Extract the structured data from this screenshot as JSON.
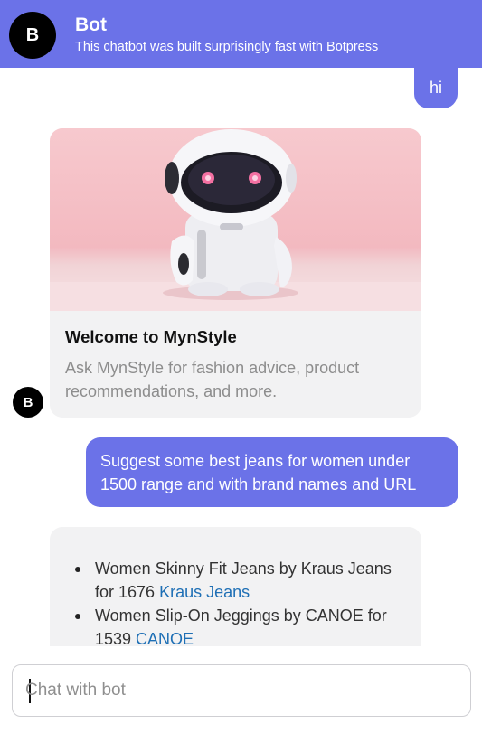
{
  "header": {
    "avatar_letter": "B",
    "bot_name": "Bot",
    "subtitle": "This chatbot was built surprisingly fast with Botpress"
  },
  "messages": {
    "user_greeting": "hi",
    "card": {
      "image_icon": "robot-illustration",
      "title": "Welcome to MynStyle",
      "text": "Ask MynStyle for fashion advice, product recommendations, and more."
    },
    "bot_avatar_letter": "B",
    "user_query": "Suggest some best jeans for women under 1500 range and with brand names and URL",
    "answer_items": [
      {
        "text": "Women Skinny Fit Jeans by Kraus Jeans for 1676 ",
        "link": "Kraus Jeans"
      },
      {
        "text": "Women Slip-On Jeggings by CANOE for 1539 ",
        "link": "CANOE"
      }
    ]
  },
  "composer": {
    "placeholder": "Chat with bot"
  },
  "colors": {
    "accent": "#6b72e8",
    "bubble_bg": "#f2f2f3",
    "link": "#1e6fb5"
  }
}
